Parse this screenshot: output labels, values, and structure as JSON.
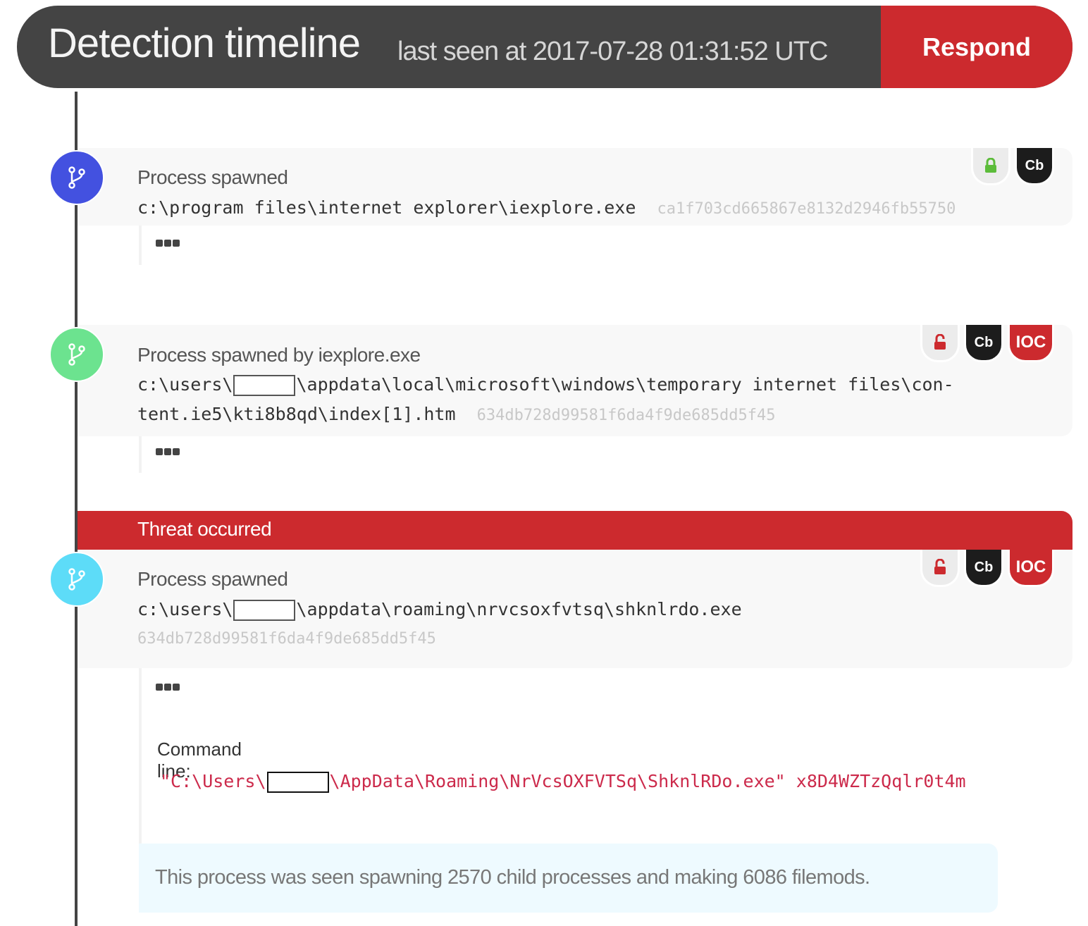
{
  "header": {
    "title": "Detection timeline",
    "subtitle": "last seen at 2017-07-28 01:31:52 UTC",
    "respond_label": "Respond"
  },
  "colors": {
    "header_bg": "#444444",
    "accent_red": "#cc2a2e",
    "node_blue": "#4351e0",
    "node_green": "#6ce38f",
    "node_cyan": "#5ddcf8",
    "lock_green": "#5cbc3a",
    "info_bg": "#eefaff"
  },
  "events": [
    {
      "label": "Process spawned",
      "node_icon": "branch-icon",
      "path_line1": "c:\\program files\\internet explorer\\iexplore.exe",
      "hash": "ca1f703cd665867e8132d2946fb55750",
      "badges": [
        {
          "type": "lock",
          "icon": "lock-closed-icon",
          "text": ""
        },
        {
          "type": "cb",
          "text": "Cb"
        }
      ],
      "more_icon": "more-dots-icon"
    },
    {
      "label": "Process spawned by iexplore.exe",
      "node_icon": "branch-icon",
      "path_pre": "c:\\users\\",
      "path_post": "\\appdata\\local\\microsoft\\windows\\temporary internet files\\con-",
      "path_line2": "tent.ie5\\kti8b8qd\\index[1].htm",
      "hash": "634db728d99581f6da4f9de685dd5f45",
      "badges": [
        {
          "type": "lock",
          "icon": "lock-open-icon",
          "text": ""
        },
        {
          "type": "cb",
          "text": "Cb"
        },
        {
          "type": "ioc",
          "text": "IOC"
        }
      ],
      "more_icon": "more-dots-icon"
    },
    {
      "threat_banner": "Threat occurred",
      "label": "Process spawned",
      "node_icon": "branch-icon",
      "path_pre": "c:\\users\\",
      "path_post": "\\appdata\\roaming\\nrvcsoxfvtsq\\shknlrdo.exe",
      "hash": "634db728d99581f6da4f9de685dd5f45",
      "badges": [
        {
          "type": "lock",
          "icon": "lock-open-icon",
          "text": ""
        },
        {
          "type": "cb",
          "text": "Cb"
        },
        {
          "type": "ioc",
          "text": "IOC"
        }
      ],
      "more_icon": "more-dots-icon",
      "command_line_label": "Command line:",
      "command_pre": "\"C:\\Users\\",
      "command_post": "\\AppData\\Roaming\\NrVcsOXFVTSq\\ShknlRDo.exe\" x8D4WZTzQqlr0t4m",
      "info_text": "This process was seen spawning 2570 child processes and making 6086 filemods."
    }
  ]
}
